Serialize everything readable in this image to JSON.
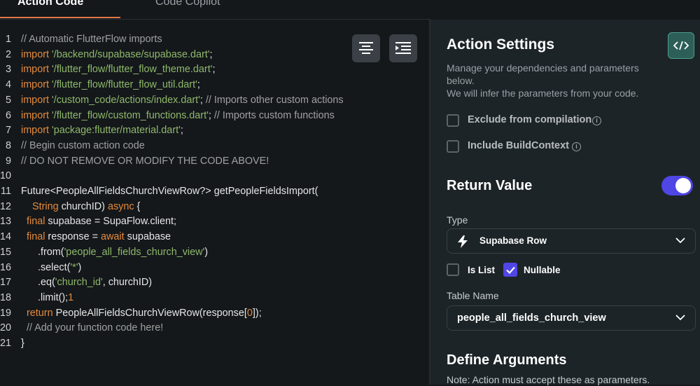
{
  "tabs": [
    {
      "label": "Action Code"
    },
    {
      "label": "Code Copilot"
    }
  ],
  "editor": {
    "toolbar": {
      "icons": [
        "align-center-icon",
        "indent-icon"
      ]
    },
    "lines": [
      {
        "n": "1",
        "text": "// Automatic FlutterFlow imports"
      },
      {
        "n": "2",
        "kw": "import ",
        "str": "'/backend/supabase/supabase.dart'",
        "rest": ";"
      },
      {
        "n": "3",
        "kw": "import ",
        "str": "'/flutter_flow/flutter_flow_theme.dart'",
        "rest": ";"
      },
      {
        "n": "4",
        "kw": "import ",
        "str": "'/flutter_flow/flutter_flow_util.dart'",
        "rest": ";"
      },
      {
        "n": "5",
        "kw": "import ",
        "str": "'/custom_code/actions/index.dart'",
        "rest": "; ",
        "cm": "// Imports other custom actions"
      },
      {
        "n": "6",
        "kw": "import ",
        "str": "'/flutter_flow/custom_functions.dart'",
        "rest": "; ",
        "cm": "// Imports custom functions"
      },
      {
        "n": "7",
        "kw": "import ",
        "str": "'package:flutter/material.dart'",
        "rest": ";"
      },
      {
        "n": "8",
        "text": "// Begin custom action code"
      },
      {
        "n": "9",
        "text": "// DO NOT REMOVE OR MODIFY THE CODE ABOVE!"
      },
      {
        "n": "10",
        "text": ""
      },
      {
        "n": "11",
        "text": "Future<PeopleAllFieldsChurchViewRow?> getPeopleFieldsImport("
      },
      {
        "n": "12",
        "pre": "    ",
        "kw": "String",
        "rest": " churchID) ",
        "kw2": "async",
        "rest2": " {"
      },
      {
        "n": "13",
        "pre": "  ",
        "kw": "final",
        "rest": " supabase = SupaFlow.client;"
      },
      {
        "n": "14",
        "pre": "  ",
        "kw": "final",
        "rest": " response = ",
        "kw2": "await",
        "rest2": " supabase"
      },
      {
        "n": "15",
        "pre": "      .from(",
        "str": "'people_all_fields_church_view'",
        "rest": ")"
      },
      {
        "n": "16",
        "pre": "      .select(",
        "str": "'*'",
        "rest": ")"
      },
      {
        "n": "17",
        "pre": "      .eq(",
        "str": "'church_id'",
        "rest": ", churchID)"
      },
      {
        "n": "18",
        "pre": "      .limit(",
        "num": "1",
        "rest": ");"
      },
      {
        "n": "19",
        "pre": "  ",
        "kw": "return",
        "rest": " PeopleAllFieldsChurchViewRow(response[",
        "num": "0",
        "rest2": "]);"
      },
      {
        "n": "20",
        "text": "  // Add your function code here!"
      },
      {
        "n": "21",
        "text": "}"
      }
    ]
  },
  "settings": {
    "title": "Action Settings",
    "desc_line1": "Manage your dependencies and parameters",
    "desc_line2": "below.",
    "desc_line3": "We will infer the parameters from your code.",
    "exclude_label": "Exclude from compilation",
    "exclude_checked": false,
    "buildcontext_label": "Include BuildContext",
    "buildcontext_checked": false,
    "code_icon": "code-brackets-icon"
  },
  "return_value": {
    "title": "Return Value",
    "enabled": true,
    "type_label": "Type",
    "type_value": "Supabase Row",
    "type_icon": "lightning-bolt-icon",
    "is_list_label": "Is List",
    "is_list_checked": false,
    "nullable_label": "Nullable",
    "nullable_checked": true,
    "table_label": "Table Name",
    "table_value": "people_all_fields_church_view"
  },
  "arguments": {
    "title": "Define Arguments",
    "note": "Note: Action must accept these as parameters."
  },
  "colors": {
    "accent_orange": "#e4774a",
    "primary": "#4f46e5",
    "background": "#14181b",
    "panel": "#1d2428"
  }
}
